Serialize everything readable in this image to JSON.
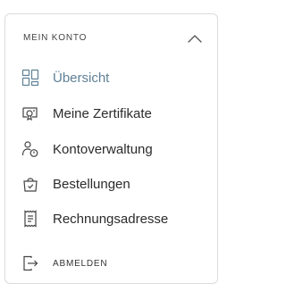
{
  "menu": {
    "title": "MEIN KONTO",
    "collapse_icon": "chevron-up-icon",
    "items": [
      {
        "label": "Übersicht",
        "icon": "dashboard-grid-icon",
        "active": true
      },
      {
        "label": "Meine Zertifikate",
        "icon": "certificate-icon",
        "active": false
      },
      {
        "label": "Kontoverwaltung",
        "icon": "user-settings-icon",
        "active": false
      },
      {
        "label": "Bestellungen",
        "icon": "shopping-bag-icon",
        "active": false
      },
      {
        "label": "Rechnungsadresse",
        "icon": "receipt-icon",
        "active": false
      }
    ],
    "logout_label": "ABMELDEN",
    "logout_icon": "logout-icon"
  },
  "colors": {
    "active": "#5f8095",
    "text": "#2b2b2b",
    "border": "#dcdcdc"
  }
}
